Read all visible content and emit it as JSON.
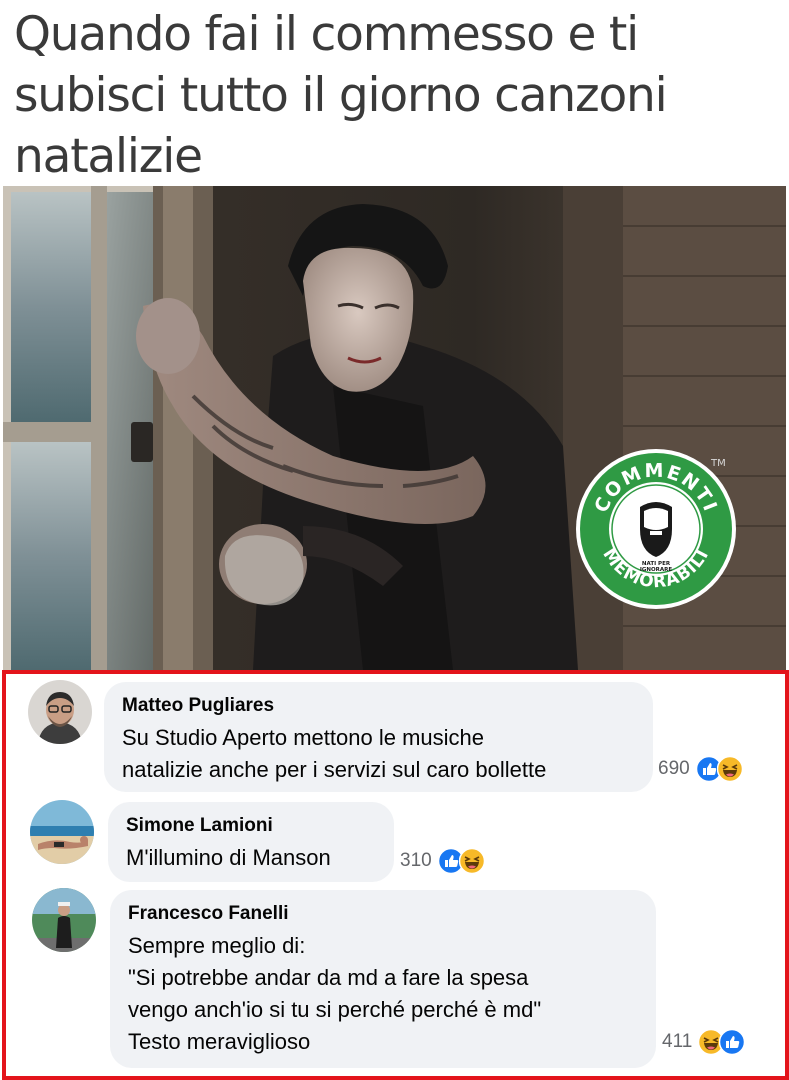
{
  "meme": {
    "caption_lines": [
      "Quando fai il commesso e ti",
      "subisci tutto il giorno canzoni",
      "natalizie"
    ]
  },
  "logo": {
    "top_text": "COMMENTI",
    "bottom_text": "MEMORABILI",
    "small_text_1": "NATI PER",
    "small_text_2": "IGNORARE",
    "tm": "TM",
    "brand_green": "#2f9a44"
  },
  "comments": [
    {
      "author": "Matteo Pugliares",
      "lines": [
        "Su Studio Aperto mettono le musiche",
        "natalizie anche per i servizi sul caro bollette"
      ],
      "count": "690",
      "reactions": [
        "like-icon",
        "haha-icon"
      ]
    },
    {
      "author": "Simone Lamioni",
      "lines": [
        "M'illumino di Manson"
      ],
      "count": "310",
      "reactions": [
        "like-icon",
        "haha-icon"
      ]
    },
    {
      "author": "Francesco Fanelli",
      "lines": [
        "Sempre meglio di:",
        "\"Si potrebbe andar da md a fare la spesa",
        "vengo anch'io si tu si perché perché è md\"",
        "Testo meraviglioso"
      ],
      "count": "411",
      "reactions": [
        "haha-icon",
        "like-icon"
      ]
    }
  ],
  "colors": {
    "highlight_border": "#e3141b",
    "bubble_bg": "#f0f2f5",
    "like_blue": "#1877f2",
    "haha_yellow": "#f7b928"
  }
}
